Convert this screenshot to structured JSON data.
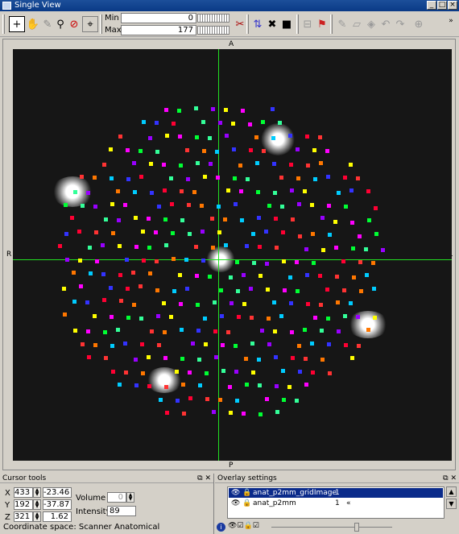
{
  "window": {
    "title": "Single View"
  },
  "toolbar": {
    "min_label": "Min",
    "min_value": "0",
    "max_label": "Max",
    "max_value": "177"
  },
  "orientation": {
    "top": "A",
    "bottom": "P",
    "left": "R",
    "right": "L"
  },
  "cursor_tools": {
    "title": "Cursor tools",
    "x_label": "X",
    "x_voxel": "433",
    "x_world": "-23.46",
    "y_label": "Y",
    "y_voxel": "192",
    "y_world": "-37.87",
    "z_label": "Z",
    "z_voxel": "321",
    "z_world": "1.62",
    "volume_label": "Volume",
    "volume_value": "0",
    "intensity_label": "Intensity",
    "intensity_value": "89",
    "coordinate_space": "Coordinate space: Scanner Anatomical"
  },
  "overlay_settings": {
    "title": "Overlay settings",
    "overlays": [
      {
        "name": "anat_p2mm_gridImage",
        "index": "1",
        "selected": true
      },
      {
        "name": "anat_p2mm",
        "index": "1",
        "selected": false
      }
    ]
  },
  "dot_colors": [
    "#ff0033",
    "#00ff33",
    "#3333ff",
    "#ff00ff",
    "#00ccff",
    "#ffff00",
    "#ff7700",
    "#9900ff",
    "#ff3333",
    "#33ff99"
  ]
}
